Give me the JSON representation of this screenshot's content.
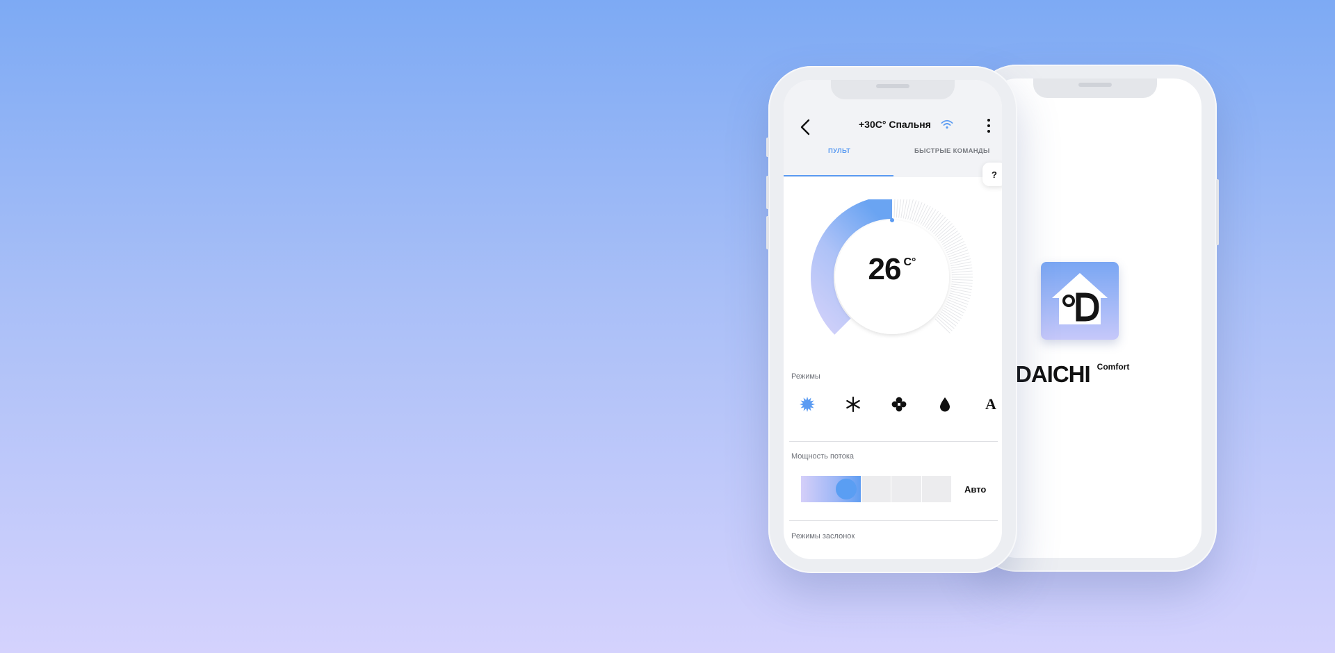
{
  "splash": {
    "brand_name": "DAICHI",
    "brand_degree": "°",
    "brand_sub": "Comfort",
    "logo_icon": "house-d-logo"
  },
  "header": {
    "back_icon": "chevron-left-icon",
    "title": "+30C° Спальня",
    "wifi_icon": "wifi-icon",
    "menu_icon": "more-vertical-icon"
  },
  "tabs": [
    {
      "label": "ПУЛЬТ",
      "active": true
    },
    {
      "label": "БЫСТРЫЕ КОМАНДЫ",
      "active": false
    }
  ],
  "help": {
    "label": "?"
  },
  "thermostat": {
    "temperature": "26",
    "unit": "C°",
    "level_fraction": 0.5
  },
  "modes": {
    "label": "Режимы",
    "items": [
      {
        "name": "heat",
        "icon": "sun-icon",
        "active": true
      },
      {
        "name": "cool",
        "icon": "snowflake-icon",
        "active": false
      },
      {
        "name": "fan",
        "icon": "fan-icon",
        "active": false
      },
      {
        "name": "dry",
        "icon": "drop-icon",
        "active": false
      },
      {
        "name": "auto",
        "icon": "auto-icon",
        "glyph": "A",
        "active": false
      }
    ]
  },
  "flow": {
    "label": "Мощность потока",
    "segments": 5,
    "level": 2,
    "auto_label": "Авто"
  },
  "dampers": {
    "label": "Режимы заслонок"
  },
  "colors": {
    "accent": "#5b9bf2",
    "text": "#111111",
    "muted": "#6e7178"
  }
}
